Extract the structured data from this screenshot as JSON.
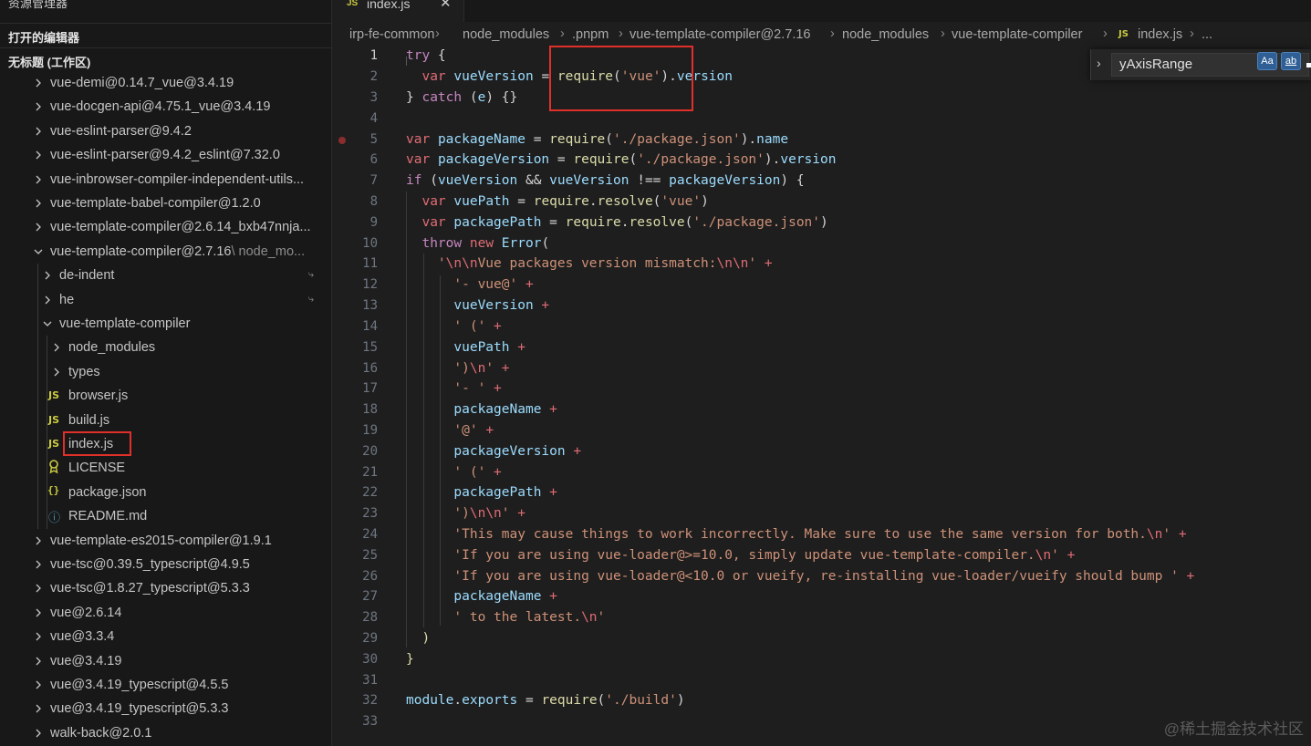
{
  "sidebar": {
    "header": "资源管理器",
    "header_more": "···",
    "open_editors": "打开的编辑器",
    "workspace": "无标题 (工作区)",
    "items": [
      {
        "label": "vue-demi@0.14.7_vue@3.4.19",
        "desc": ""
      },
      {
        "label": "vue-docgen-api@4.75.1_vue@3.4.19",
        "desc": ""
      },
      {
        "label": "vue-eslint-parser@9.4.2",
        "desc": ""
      },
      {
        "label": "vue-eslint-parser@9.4.2_eslint@7.32.0",
        "desc": ""
      },
      {
        "label": "vue-inbrowser-compiler-independent-utils...",
        "desc": ""
      },
      {
        "label": "vue-template-babel-compiler@1.2.0",
        "desc": ""
      },
      {
        "label": "vue-template-compiler@2.6.14_bxb47nnja...",
        "desc": ""
      },
      {
        "label": "vue-template-compiler@2.7.16",
        "desc": "\\ node_mo..."
      },
      {
        "label": "de-indent",
        "desc": ""
      },
      {
        "label": "he",
        "desc": ""
      },
      {
        "label": "vue-template-compiler",
        "desc": ""
      },
      {
        "label": "node_modules",
        "desc": ""
      },
      {
        "label": "types",
        "desc": ""
      },
      {
        "label": "browser.js",
        "desc": ""
      },
      {
        "label": "build.js",
        "desc": ""
      },
      {
        "label": "index.js",
        "desc": ""
      },
      {
        "label": "LICENSE",
        "desc": ""
      },
      {
        "label": "package.json",
        "desc": ""
      },
      {
        "label": "README.md",
        "desc": ""
      },
      {
        "label": "vue-template-es2015-compiler@1.9.1",
        "desc": ""
      },
      {
        "label": "vue-tsc@0.39.5_typescript@4.9.5",
        "desc": ""
      },
      {
        "label": "vue-tsc@1.8.27_typescript@5.3.3",
        "desc": ""
      },
      {
        "label": "vue@2.6.14",
        "desc": ""
      },
      {
        "label": "vue@3.3.4",
        "desc": ""
      },
      {
        "label": "vue@3.4.19",
        "desc": ""
      },
      {
        "label": "vue@3.4.19_typescript@4.5.5",
        "desc": ""
      },
      {
        "label": "vue@3.4.19_typescript@5.3.3",
        "desc": ""
      },
      {
        "label": "walk-back@2.0.1",
        "desc": ""
      }
    ],
    "icons": {
      "js": "JS",
      "json": "{}",
      "license": "license-icon",
      "info": "ⓘ",
      "pin": "⤷"
    }
  },
  "tab": {
    "name": "index.js",
    "icon": "JS",
    "close": "✕"
  },
  "breadcrumb": {
    "items": [
      "irp-fe-common",
      "node_modules",
      ".pnpm",
      "vue-template-compiler@2.7.16",
      "node_modules",
      "vue-template-compiler",
      "index.js",
      "..."
    ],
    "file_icon": "JS"
  },
  "find_widget": {
    "value": "yAxisRange",
    "match_case": "Aa",
    "whole_word": "ab"
  },
  "line_numbers": [
    "1",
    "2",
    "3",
    "4",
    "5",
    "6",
    "7",
    "8",
    "9",
    "10",
    "11",
    "12",
    "13",
    "14",
    "15",
    "16",
    "17",
    "18",
    "19",
    "20",
    "21",
    "22",
    "23",
    "24",
    "25",
    "26",
    "27",
    "28",
    "29",
    "30",
    "31",
    "32",
    "33"
  ],
  "code": {
    "l1a": "try",
    "l1b": " {",
    "l2a": "var",
    "l2b": "vueVersion",
    "l2c": " = ",
    "l2d": "require",
    "l2e": "(",
    "l2f": "'vue'",
    "l2g": ").",
    "l2h": "version",
    "l3a": "} ",
    "l3b": "catch",
    "l3c": " (",
    "l3d": "e",
    "l3e": ") {}",
    "l5a": "var",
    "l5b": "packageName",
    "l5c": " = ",
    "l5d": "require",
    "l5e": "(",
    "l5f": "'./package.json'",
    "l5g": ").",
    "l5h": "name",
    "l6a": "var",
    "l6b": "packageVersion",
    "l6c": " = ",
    "l6d": "require",
    "l6e": "(",
    "l6f": "'./package.json'",
    "l6g": ").",
    "l6h": "version",
    "l7a": "if",
    "l7b": " (",
    "l7c": "vueVersion",
    "l7d": " && ",
    "l7e": "vueVersion",
    "l7f": " !== ",
    "l7g": "packageVersion",
    "l7h": ") {",
    "l8a": "var",
    "l8b": "vuePath",
    "l8c": " = ",
    "l8d": "require",
    "l8e": ".",
    "l8f": "resolve",
    "l8g": "(",
    "l8h": "'vue'",
    "l8i": ")",
    "l9a": "var",
    "l9b": "packagePath",
    "l9c": " = ",
    "l9d": "require",
    "l9e": ".",
    "l9f": "resolve",
    "l9g": "(",
    "l9h": "'./package.json'",
    "l9i": ")",
    "l10a": "throw",
    "l10b": " ",
    "l10c": "new",
    "l10d": " ",
    "l10e": "Error",
    "l10f": "(",
    "l11a": "'",
    "l11b": "\\n\\n",
    "l11c": "Vue packages version mismatch:",
    "l11d": "\\n\\n",
    "l11e": "'",
    "l11f": " +",
    "l12a": "'- vue@'",
    "l12b": " +",
    "l13a": "vueVersion",
    "l13b": " +",
    "l14a": "' ('",
    "l14b": " +",
    "l15a": "vuePath",
    "l15b": " +",
    "l16a": "')",
    "l16b": "\\n",
    "l16c": "'",
    "l16d": " +",
    "l17a": "'- '",
    "l17b": " +",
    "l18a": "packageName",
    "l18b": " +",
    "l19a": "'@'",
    "l19b": " +",
    "l20a": "packageVersion",
    "l20b": " +",
    "l21a": "' ('",
    "l21b": " +",
    "l22a": "packagePath",
    "l22b": " +",
    "l23a": "')",
    "l23b": "\\n\\n",
    "l23c": "'",
    "l23d": " +",
    "l24a": "'This may cause things to work incorrectly. Make sure to use the same version for both.",
    "l24b": "\\n",
    "l24c": "'",
    "l24d": " +",
    "l25a": "'If you are using vue-loader@>=10.0, simply update vue-template-compiler.",
    "l25b": "\\n",
    "l25c": "'",
    "l25d": " +",
    "l26a": "'If you are using vue-loader@<10.0 or vueify, re-installing vue-loader/vueify should bump '",
    "l26b": " +",
    "l27a": "packageName",
    "l27b": " +",
    "l28a": "' to the latest.",
    "l28b": "\\n",
    "l28c": "'",
    "l29a": ")",
    "l30a": "}",
    "l32a": "module",
    "l32b": ".",
    "l32c": "exports",
    "l32d": " = ",
    "l32e": "require",
    "l32f": "(",
    "l32g": "'./build'",
    "l32h": ")"
  },
  "watermark": "@稀土掘金技术社区",
  "colors": {
    "highlight_box": "#e0302a",
    "keyword": "#c586c0",
    "variable": "#9cdcfe",
    "function": "#dcdcaa",
    "string": "#ce9178"
  }
}
